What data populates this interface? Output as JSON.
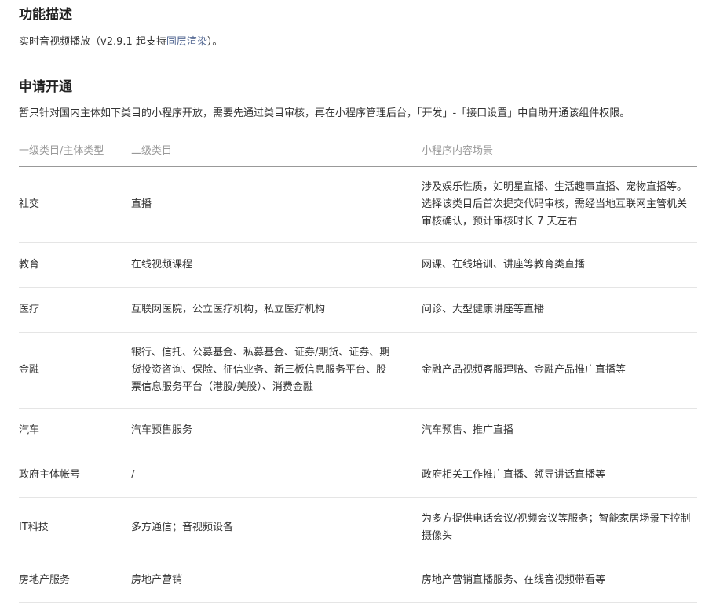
{
  "section_function": {
    "title": "功能描述",
    "text_before": "实时音视频播放（v2.9.1 起支持",
    "link": "同层渲染",
    "text_after": "）。"
  },
  "section_apply": {
    "title": "申请开通",
    "text": "暂只针对国内主体如下类目的小程序开放，需要先通过类目审核，再在小程序管理后台，「开发」-「接口设置」中自助开通该组件权限。"
  },
  "table": {
    "headers": [
      "一级类目/主体类型",
      "二级类目",
      "小程序内容场景"
    ],
    "rows": [
      {
        "c1": "社交",
        "c2": "直播",
        "c3": "涉及娱乐性质，如明星直播、生活趣事直播、宠物直播等。选择该类目后首次提交代码审核，需经当地互联网主管机关审核确认，预计审核时长 7 天左右"
      },
      {
        "c1": "教育",
        "c2": "在线视频课程",
        "c3": "网课、在线培训、讲座等教育类直播"
      },
      {
        "c1": "医疗",
        "c2": "互联网医院，公立医疗机构，私立医疗机构",
        "c3": "问诊、大型健康讲座等直播"
      },
      {
        "c1": "金融",
        "c2": "银行、信托、公募基金、私募基金、证券/期货、证券、期货投资咨询、保险、征信业务、新三板信息服务平台、股票信息服务平台（港股/美股）、消费金融",
        "c3": "金融产品视频客服理赔、金融产品推广直播等"
      },
      {
        "c1": "汽车",
        "c2": "汽车预售服务",
        "c3": "汽车预售、推广直播"
      },
      {
        "c1": "政府主体帐号",
        "c2": "/",
        "c3": "政府相关工作推广直播、领导讲话直播等"
      },
      {
        "c1": "IT科技",
        "c2": "多方通信；音视频设备",
        "c3": "为多方提供电话会议/视频会议等服务；智能家居场景下控制摄像头"
      },
      {
        "c1": "房地产服务",
        "c2": "房地产营销",
        "c3": "房地产营销直播服务、在线音视频带看等"
      }
    ]
  }
}
